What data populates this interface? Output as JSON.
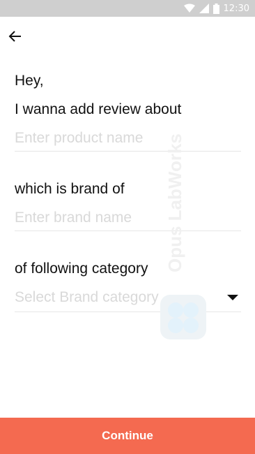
{
  "status_bar": {
    "time": "12:30",
    "icons": [
      "wifi-icon",
      "signal-icon",
      "battery-icon"
    ]
  },
  "header": {
    "back_icon": "arrow-left-icon"
  },
  "form": {
    "greeting": "Hey,",
    "product_label": "I wanna add review about",
    "product_placeholder": "Enter product name",
    "brand_label": "which is brand of",
    "brand_placeholder": "Enter brand name",
    "category_label": "of following category",
    "category_placeholder": "Select Brand category"
  },
  "watermark": {
    "text": "Opus LabWorks"
  },
  "footer": {
    "continue_label": "Continue"
  },
  "colors": {
    "accent": "#f46a50",
    "status_bar": "#cfcfcf",
    "placeholder": "#d9d9d9"
  }
}
